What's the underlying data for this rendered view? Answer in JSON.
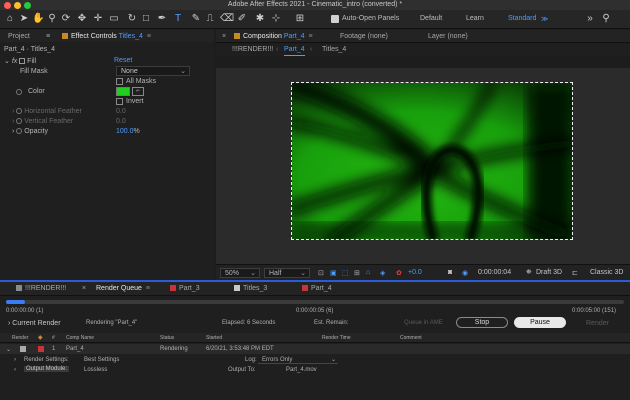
{
  "window": {
    "title": "Adobe After Effects 2021 - Cinematic_intro (converted) *"
  },
  "toolbar": {
    "auto_open_panels": "Auto-Open Panels",
    "workspaces": [
      "Default",
      "Learn",
      "Standard"
    ],
    "menu_glyph": "≫"
  },
  "project_tab": "Project",
  "effect_controls": {
    "tab_label": "Effect Controls",
    "tab_layer": "Titles_4",
    "header": "Part_4 · Titles_4",
    "effect_name": "Fill",
    "reset": "Reset",
    "fill_mask_label": "Fill Mask",
    "fill_mask_value": "None",
    "all_masks": "All Masks",
    "color_label": "Color",
    "invert": "Invert",
    "horizontal_feather_label": "Horizontal Feather",
    "horizontal_feather_value": "0.0",
    "vertical_feather_label": "Vertical Feather",
    "vertical_feather_value": "0.0",
    "opacity_label": "Opacity",
    "opacity_value": "100.0",
    "opacity_unit": "%"
  },
  "composition": {
    "tab_prefix": "Composition",
    "tab_name": "Part_4",
    "footage": "Footage (none)",
    "layer": "Layer (none)",
    "breadcrumbs": [
      "!!!RENDER!!!",
      "Part_4",
      "Titles_4"
    ],
    "zoom": "50%",
    "resolution": "Half",
    "exposure": "+0.0",
    "timecode": "0:00:00:04",
    "renderer": "Draft 3D",
    "classic": "Classic 3D"
  },
  "render_queue": {
    "tabs": [
      {
        "label": "!!!RENDER!!!",
        "color": "#8a8a8a"
      },
      {
        "label": "Render Queue",
        "color": null
      },
      {
        "label": "Part_3",
        "color": "#c8343a"
      },
      {
        "label": "Titles_3",
        "color": "#c8c8c8"
      },
      {
        "label": "Part_4",
        "color": "#c8343a"
      }
    ],
    "progress_fraction": 0.03,
    "time_start": "0:00:00:00 (1)",
    "time_current": "0:00:00:05 (6)",
    "time_end": "0:00:05:00 (151)",
    "current_render_label": "Current Render",
    "rendering_status": "Rendering \"Part_4\"",
    "elapsed": "Elapsed: 6 Seconds",
    "est_remain": "Est. Remain:",
    "queue_in_ame": "Queue in AME",
    "stop": "Stop",
    "pause": "Pause",
    "render": "Render",
    "columns": [
      "Render",
      "#",
      "Comp Name",
      "Status",
      "Started",
      "Render Time",
      "Comment"
    ],
    "items": [
      {
        "number": "1",
        "comp_name": "Part_4",
        "status": "Rendering",
        "started": "6/20/21, 3:53:48 PM EDT",
        "color": "#c8343a"
      }
    ],
    "render_settings_label": "Render Settings:",
    "render_settings_value": "Best Settings",
    "log_label": "Log:",
    "log_value": "Errors Only",
    "output_module_label": "Output Module:",
    "output_module_value": "Lossless",
    "output_to_label": "Output To:",
    "output_to_value": "Part_4.mov"
  }
}
